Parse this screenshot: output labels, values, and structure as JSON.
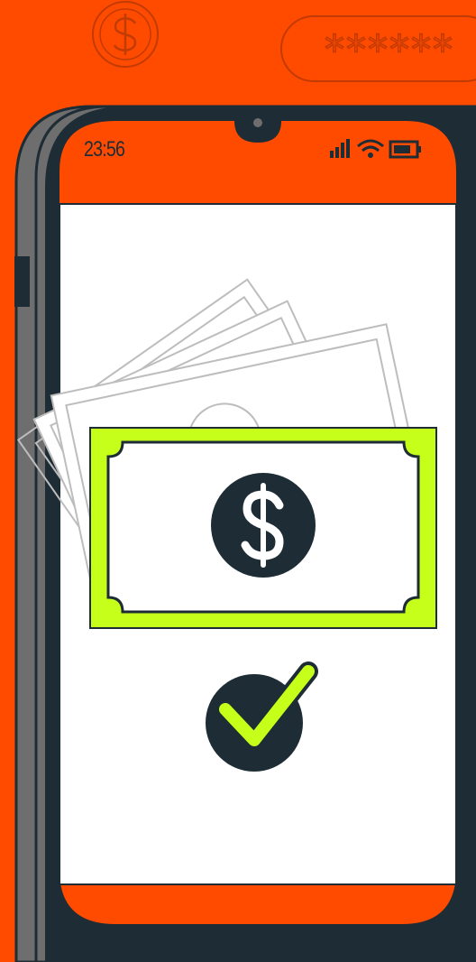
{
  "status_bar": {
    "time": "23:56",
    "signal_icon": "signal-bars-icon",
    "wifi_icon": "wifi-icon",
    "battery_icon": "battery-icon"
  },
  "header": {
    "coin_icon": "dollar-coin-icon",
    "password_mask": "******"
  },
  "main": {
    "banknote_icon": "dollar-banknote-icon",
    "stack_icon": "banknote-stack-icon",
    "confirm_icon": "checkmark-circle-icon"
  },
  "colors": {
    "background": "#ff4b00",
    "dark": "#1e2d35",
    "accent": "#c6ff1a",
    "screen": "#ffffff"
  }
}
